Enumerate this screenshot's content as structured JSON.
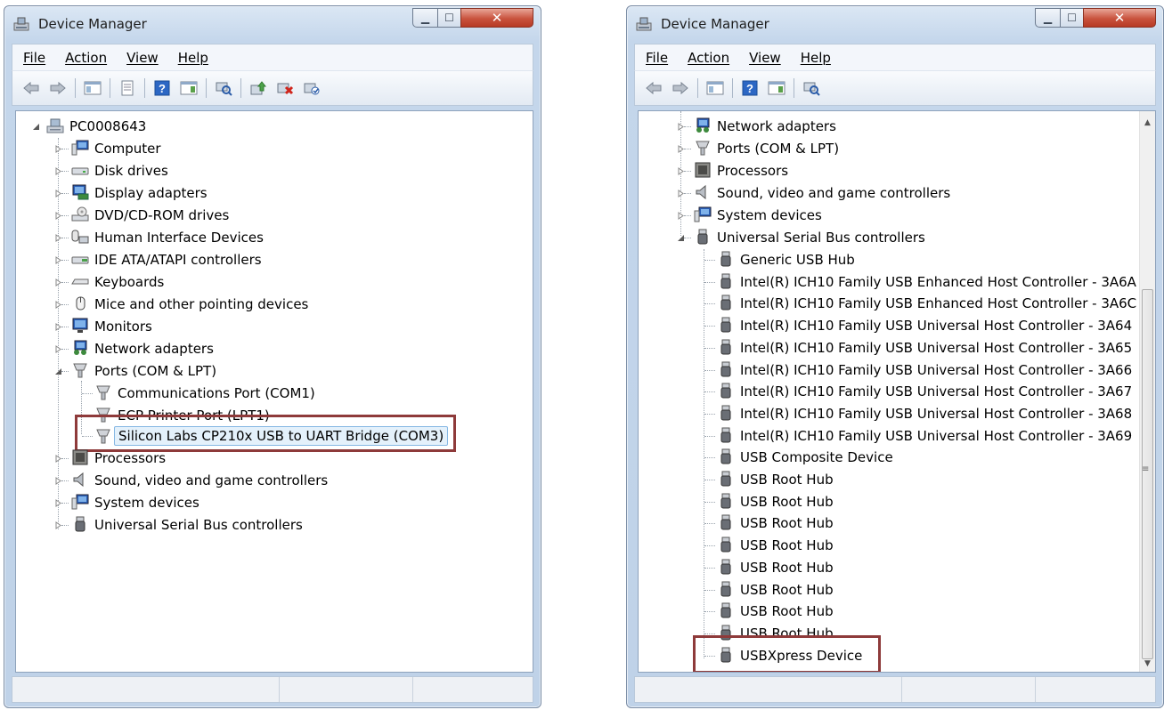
{
  "left_window": {
    "title": "Device Manager",
    "menu": [
      "File",
      "Action",
      "View",
      "Help"
    ],
    "computer": "PC0008643",
    "categories": [
      "Computer",
      "Disk drives",
      "Display adapters",
      "DVD/CD-ROM drives",
      "Human Interface Devices",
      "IDE ATA/ATAPI controllers",
      "Keyboards",
      "Mice and other pointing devices",
      "Monitors",
      "Network adapters",
      "Ports (COM & LPT)"
    ],
    "ports_children": [
      "Communications Port (COM1)",
      "ECP Printer Port (LPT1)",
      "Silicon Labs CP210x USB to UART Bridge (COM3)"
    ],
    "categories_after": [
      "Processors",
      "Sound, video and game controllers",
      "System devices",
      "Universal Serial Bus controllers"
    ]
  },
  "right_window": {
    "title": "Device Manager",
    "menu": [
      "File",
      "Action",
      "View",
      "Help"
    ],
    "categories": [
      "Network adapters",
      "Ports (COM & LPT)",
      "Processors",
      "Sound, video and game controllers",
      "System devices",
      "Universal Serial Bus controllers"
    ],
    "usb_children": [
      "Generic USB Hub",
      "Intel(R) ICH10 Family USB Enhanced Host Controller - 3A6A",
      "Intel(R) ICH10 Family USB Enhanced Host Controller - 3A6C",
      "Intel(R) ICH10 Family USB Universal Host Controller - 3A64",
      "Intel(R) ICH10 Family USB Universal Host Controller - 3A65",
      "Intel(R) ICH10 Family USB Universal Host Controller - 3A66",
      "Intel(R) ICH10 Family USB Universal Host Controller - 3A67",
      "Intel(R) ICH10 Family USB Universal Host Controller - 3A68",
      "Intel(R) ICH10 Family USB Universal Host Controller - 3A69",
      "USB Composite Device",
      "USB Root Hub",
      "USB Root Hub",
      "USB Root Hub",
      "USB Root Hub",
      "USB Root Hub",
      "USB Root Hub",
      "USB Root Hub",
      "USB Root Hub",
      "USBXpress Device"
    ]
  },
  "colors": {
    "highlight_box": "#8e3a3a",
    "selection": "#e4f1fb"
  }
}
